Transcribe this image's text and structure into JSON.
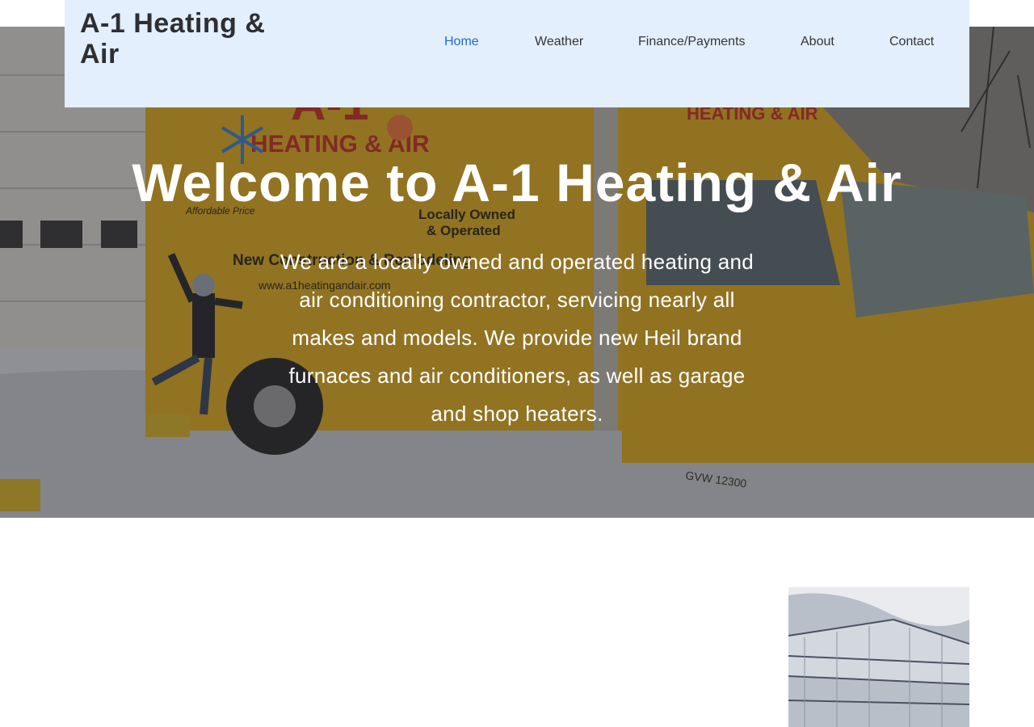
{
  "header": {
    "logo": "A-1 Heating & Air",
    "nav": [
      {
        "label": "Home",
        "active": true
      },
      {
        "label": "Weather",
        "active": false
      },
      {
        "label": "Finance/Payments",
        "active": false
      },
      {
        "label": "About",
        "active": false
      },
      {
        "label": "Contact",
        "active": false
      }
    ]
  },
  "hero": {
    "title": "Welcome to A-1 Heating & Air",
    "description": "We are a locally owned and operated heating and air conditioning contractor, servicing nearly all makes and models. We provide new Heil brand furnaces and air conditioners, as well as garage and shop heaters.",
    "truck_sign": {
      "brand_line_1": "A-1",
      "brand_line_2": "HEATING & AIR",
      "tag_1": "Locally Owned",
      "tag_2": "& Operated",
      "tag_3": "New Construction & Remodeling",
      "url": "www.a1heatingandair.com",
      "tagline": "Affordable Price",
      "cab_sign": "HEATING & AIR",
      "gvw": "GVW 12300"
    }
  },
  "colors": {
    "header_bg": "#e3effd",
    "nav_active": "#1e6bd6",
    "nav_text": "#343438",
    "logo_text": "#2f2f33",
    "truck_yellow": "#d9a923"
  },
  "icons": {
    "snowflake": "snowflake-icon",
    "sun": "sun-icon"
  }
}
